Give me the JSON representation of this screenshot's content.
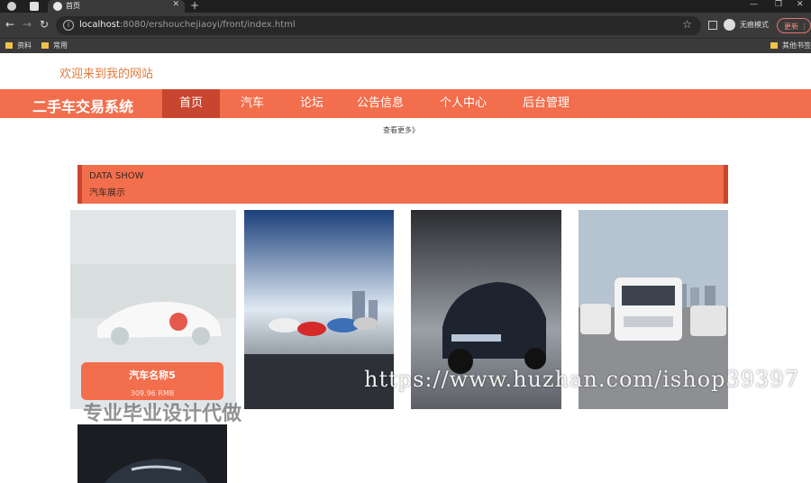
{
  "browser": {
    "tab_title": "首页",
    "url_host": "localhost",
    "url_path": ":8080/ershouchejiaoyi/front/index.html",
    "incognito_label": "无痕模式",
    "update_label": "更新",
    "bookmarks": [
      "资料",
      "常用",
      "其他书签"
    ]
  },
  "site": {
    "welcome": "欢迎来到我的网站",
    "title": "二手车交易系统",
    "nav": [
      "首页",
      "汽车",
      "论坛",
      "公告信息",
      "个人中心",
      "后台管理"
    ],
    "more_link": "查看更多》",
    "section_en": "DATA SHOW",
    "section_cn": "汽车展示"
  },
  "cars": [
    {
      "name": "汽车名称5",
      "price": "309.96 RMB"
    }
  ],
  "overlays": {
    "url_watermark": "https://www.huzhan.com/ishop39397",
    "cn_watermark": "专业毕业设计代做"
  },
  "colors": {
    "accent": "#f26e4c",
    "accent_dark": "#c8462f",
    "welcome_text": "#e07b3a"
  }
}
